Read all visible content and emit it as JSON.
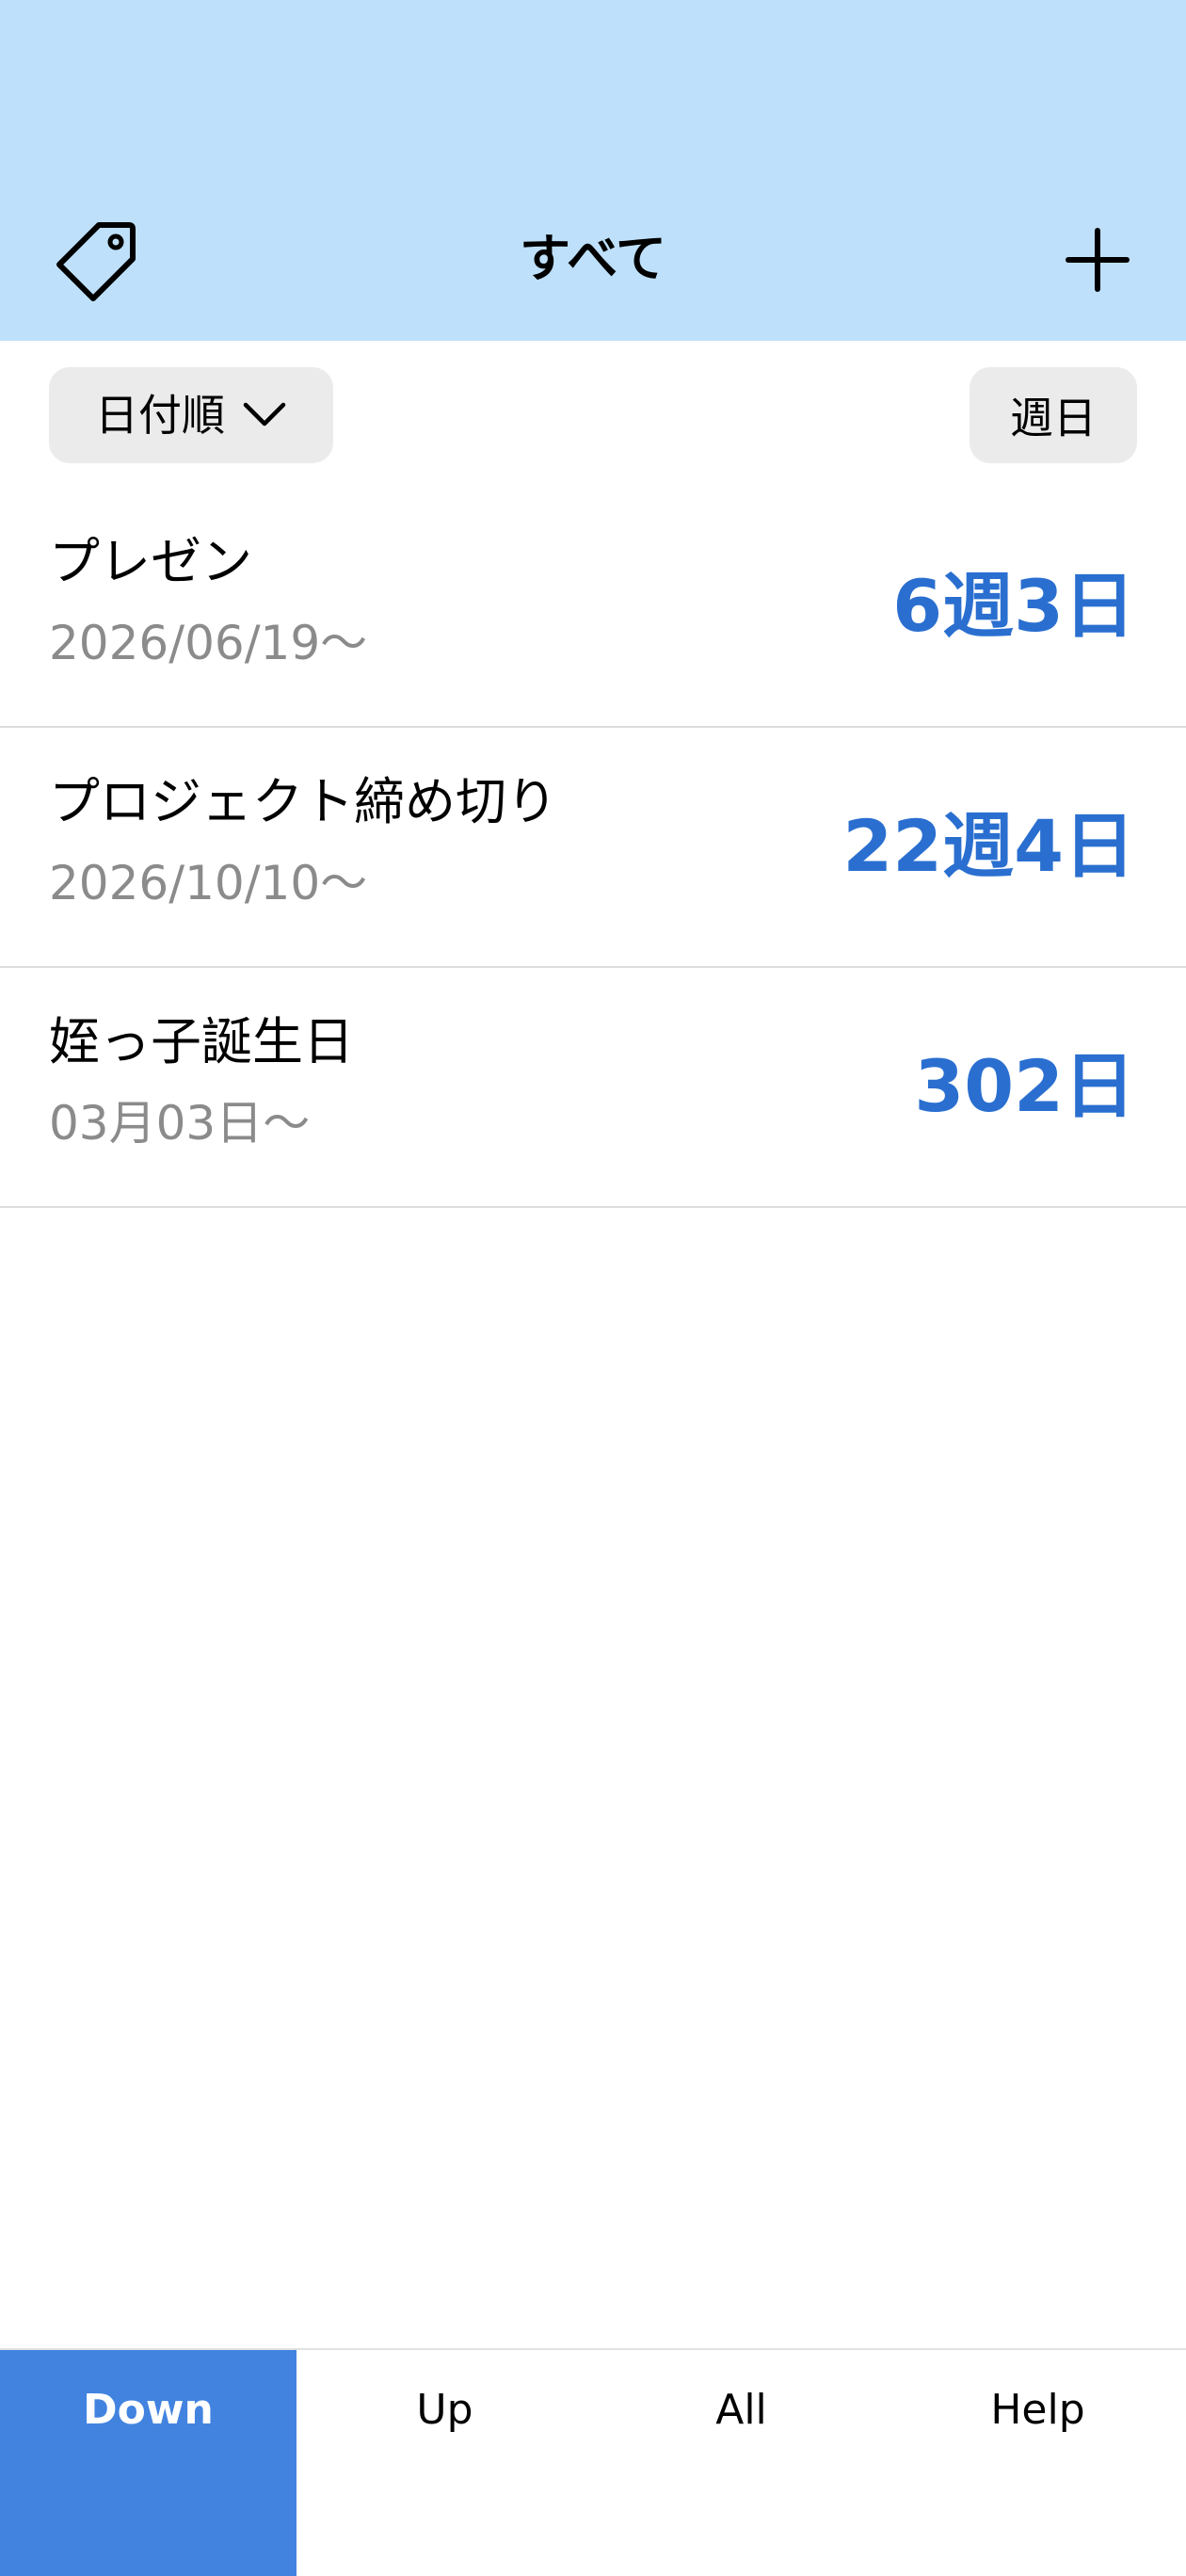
{
  "header": {
    "title": "すべて",
    "background": "#bee0fa",
    "left_icon": "tag-icon",
    "right_icon": "plus-icon"
  },
  "toolbar": {
    "sort_label": "日付順",
    "sort_icon": "chevron-down-icon",
    "unit_label": "週日"
  },
  "events": [
    {
      "title": "プレゼン",
      "date": "2026/06/19～",
      "count": "6週3日"
    },
    {
      "title": "プロジェクト締め切り",
      "date": "2026/10/10～",
      "count": "22週4日"
    },
    {
      "title": "姪っ子誕生日",
      "date": "03月03日～",
      "count": "302日"
    }
  ],
  "tabs": [
    {
      "label": "Down",
      "active": true
    },
    {
      "label": "Up",
      "active": false
    },
    {
      "label": "All",
      "active": false
    },
    {
      "label": "Help",
      "active": false
    }
  ],
  "colors": {
    "accent": "#2a6fd0",
    "active_tab": "#4283e0",
    "secondary_text": "#8b8b8b",
    "button_bg": "#ebebeb"
  }
}
